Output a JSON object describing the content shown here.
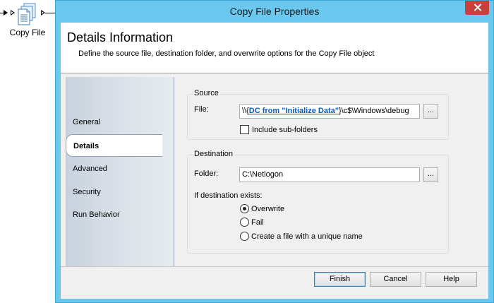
{
  "canvas": {
    "node_label": "Copy File",
    "icon": "document-icon"
  },
  "window": {
    "title": "Copy File Properties",
    "close_icon": "close-icon"
  },
  "header": {
    "title": "Details Information",
    "description": "Define the source file, destination folder, and overwrite options for the Copy File object"
  },
  "nav": {
    "items": [
      {
        "label": "General"
      },
      {
        "label": "Details"
      },
      {
        "label": "Advanced"
      },
      {
        "label": "Security"
      },
      {
        "label": "Run Behavior"
      }
    ],
    "active": "Details"
  },
  "source": {
    "legend": "Source",
    "file_label": "File:",
    "file_value_prefix": "\\\\{",
    "file_value_link": "DC from \"Initialize Data\"",
    "file_value_suffix": "}\\c$\\Windows\\debug",
    "browse_label": "...",
    "include_subfolders_label": "Include sub-folders",
    "include_subfolders_checked": false
  },
  "destination": {
    "legend": "Destination",
    "folder_label": "Folder:",
    "folder_value": "C:\\Netlogon",
    "browse_label": "...",
    "exists_label": "If destination exists:",
    "options": [
      {
        "label": "Overwrite",
        "checked": true
      },
      {
        "label": "Fail",
        "checked": false
      },
      {
        "label": "Create a file with a unique name",
        "checked": false
      }
    ]
  },
  "footer": {
    "finish_label": "Finish",
    "cancel_label": "Cancel",
    "help_label": "Help"
  },
  "colors": {
    "window_frame": "#6ac8ee",
    "close_button": "#c7413c",
    "link": "#0b5bbd"
  }
}
